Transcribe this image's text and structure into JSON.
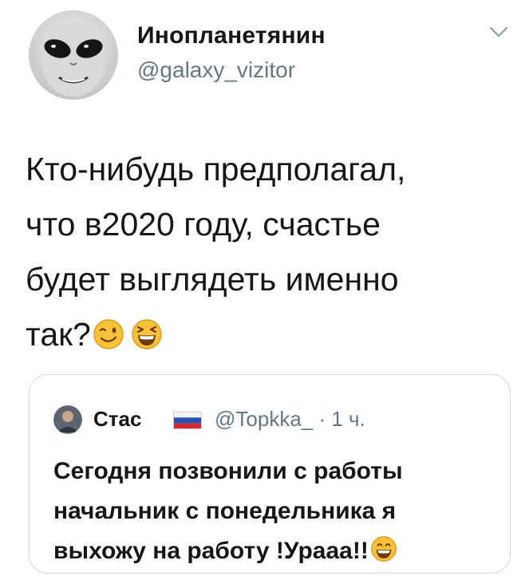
{
  "author": {
    "display_name": "Инопланетянин",
    "handle": "@galaxy_vizitor",
    "avatar_icon": "alien-face-avatar"
  },
  "menu": {
    "icon": "chevron-down-icon"
  },
  "tweet": {
    "lines": [
      "Кто-нибудь предполагал,",
      "что в2020 году,  счастье",
      "будет выглядеть именно",
      "так?"
    ],
    "emojis": [
      "winking-face-emoji",
      "grinning-squinting-face-emoji"
    ]
  },
  "quoted_tweet": {
    "author_name": "Стас",
    "flag_icon": "russia-flag-icon",
    "handle": "@Topkka_",
    "time": "· 1 ч.",
    "lines": [
      "Сегодня позвонили с работы",
      "начальник с понедельника я",
      "выхожу на работу !Урааа!!"
    ],
    "emoji": "grinning-face-emoji"
  },
  "colors": {
    "text": "#14171a",
    "secondary": "#657786",
    "border": "#ccd6dd",
    "emoji_yellow": "#f7c23a"
  }
}
